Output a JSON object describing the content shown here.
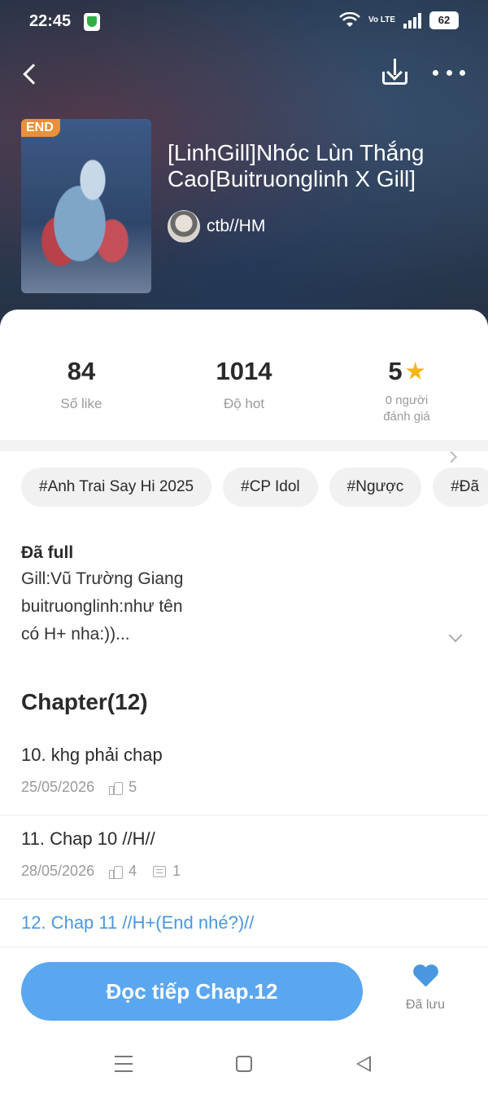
{
  "status_bar": {
    "time": "22:45",
    "network": "Vo LTE",
    "battery": "62"
  },
  "story": {
    "badge": "END",
    "title": "[LinhGill]Nhóc Lùn Thắng Cao[Buitruonglinh X Gill]",
    "author": "ctb//HM"
  },
  "stats": {
    "likes": {
      "value": "84",
      "label": "Số like"
    },
    "hot": {
      "value": "1014",
      "label": "Độ hot"
    },
    "rating": {
      "value": "5",
      "label_line1": "0 người",
      "label_line2": "đánh giá"
    }
  },
  "tags": [
    "#Anh Trai Say Hi 2025",
    "#CP Idol",
    "#Ngược",
    "#Đã"
  ],
  "description": {
    "status": "Đã full",
    "lines": [
      "Gill:Vũ Trường Giang",
      "buitruonglinh:như tên",
      "có H+ nha:))..."
    ]
  },
  "chapter_header": "Chapter(12)",
  "chapters": [
    {
      "title": "10. khg phải chap",
      "date": "25/05/2026",
      "likes": "5",
      "comments": ""
    },
    {
      "title": "11. Chap 10 //H//",
      "date": "28/05/2026",
      "likes": "4",
      "comments": "1"
    },
    {
      "title": "12. Chap 11 //H+(End nhé?)//",
      "date": "",
      "likes": "",
      "comments": ""
    }
  ],
  "actions": {
    "read_button": "Đọc tiếp Chap.12",
    "saved_label": "Đã lưu"
  },
  "colors": {
    "accent": "#5aa7f0",
    "link": "#4a97e0",
    "badge": "#e8913a",
    "star": "#f5b61a"
  },
  "icons": [
    "back-icon",
    "download-icon",
    "more-icon",
    "star-icon",
    "chevron-right-icon",
    "chevron-down-icon",
    "thumb-up-icon",
    "comment-icon",
    "heart-icon",
    "menu-icon",
    "home-icon",
    "nav-back-icon"
  ]
}
